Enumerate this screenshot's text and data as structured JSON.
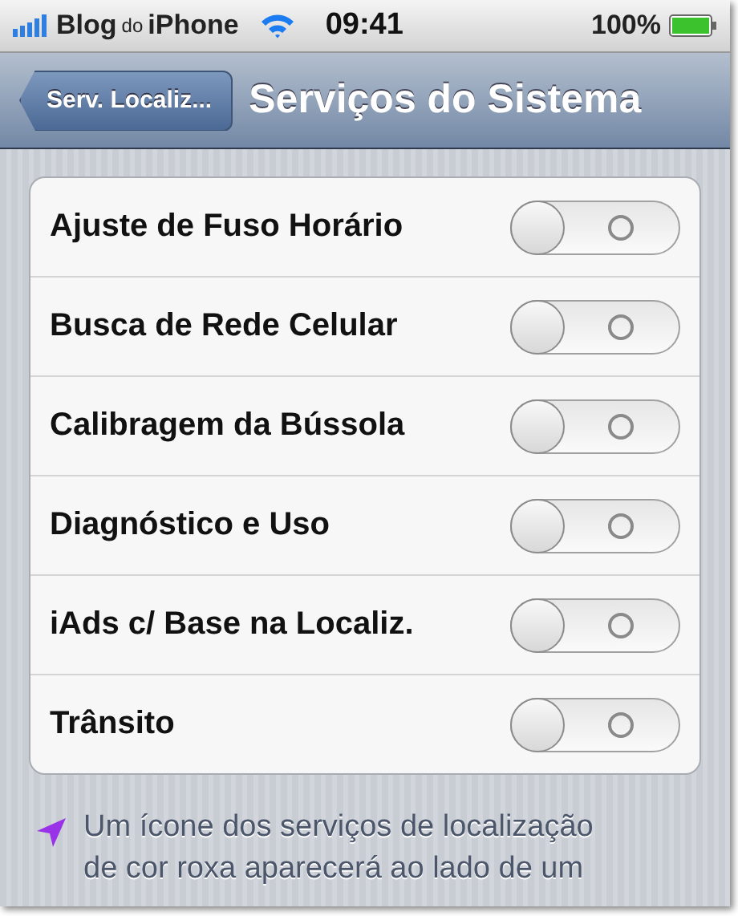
{
  "status_bar": {
    "carrier": "Blog",
    "carrier_suffix": "do",
    "carrier_brand": "iPhone",
    "time": "09:41",
    "battery": "100%"
  },
  "nav_bar": {
    "back": "Serv. Localiz...",
    "title": "Serviços do Sistema"
  },
  "settings": [
    {
      "label": "Ajuste de Fuso Horário",
      "on": false
    },
    {
      "label": "Busca de Rede Celular",
      "on": false
    },
    {
      "label": "Calibragem da Bússola",
      "on": false
    },
    {
      "label": "Diagnóstico e Uso",
      "on": false
    },
    {
      "label": "iAds c/ Base na Localiz.",
      "on": false
    },
    {
      "label": "Trânsito",
      "on": false
    }
  ],
  "footer_lines": [
    "Um ícone dos serviços de localização",
    "de cor roxa aparecerá ao lado de um"
  ]
}
